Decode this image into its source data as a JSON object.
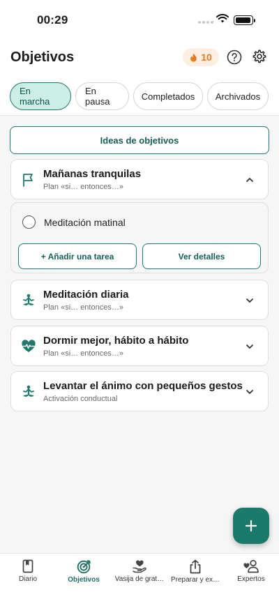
{
  "status_bar": {
    "time": "00:29"
  },
  "header": {
    "title": "Objetivos",
    "streak_count": "10"
  },
  "filters": [
    {
      "label": "En marcha",
      "active": true
    },
    {
      "label": "En pausa",
      "active": false
    },
    {
      "label": "Completados",
      "active": false
    },
    {
      "label": "Archivados",
      "active": false
    }
  ],
  "ideas_button": "Ideas de objetivos",
  "goals": [
    {
      "title": "Mañanas tranquilas",
      "subtitle": "Plan «si… entonces…»",
      "icon": "flag-icon",
      "expanded": true
    },
    {
      "title": "Meditación diaria",
      "subtitle": "Plan «si… entonces…»",
      "icon": "meditation-icon",
      "expanded": false
    },
    {
      "title": "Dormir mejor, hábito a hábito",
      "subtitle": "Plan «si… entonces…»",
      "icon": "heartbeat-icon",
      "expanded": false
    },
    {
      "title": "Levantar el ánimo con pequeños gestos",
      "subtitle": "Activación conductual",
      "icon": "meditation-icon",
      "expanded": false
    }
  ],
  "expanded_goal": {
    "task": "Meditación matinal",
    "add_task_label": "+ Añadir una tarea",
    "details_label": "Ver detalles"
  },
  "bottom_nav": [
    {
      "label": "Diario",
      "icon": "book-icon",
      "active": false
    },
    {
      "label": "Objetivos",
      "icon": "target-icon",
      "active": true
    },
    {
      "label": "Vasija de grat…",
      "icon": "gratitude-jar-icon",
      "active": false
    },
    {
      "label": "Preparar y ex…",
      "icon": "share-icon",
      "active": false
    },
    {
      "label": "Expertos",
      "icon": "experts-icon",
      "active": false
    }
  ],
  "colors": {
    "accent": "#1f7a6c",
    "streak": "#e8791e"
  }
}
